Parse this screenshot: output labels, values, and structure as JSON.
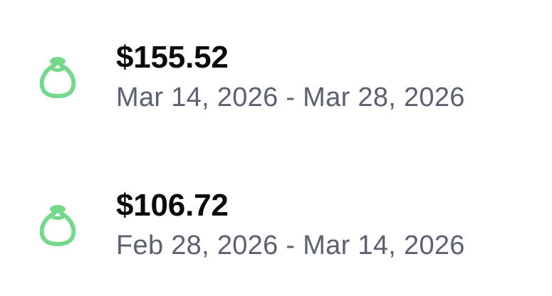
{
  "payments": [
    {
      "icon": "money-bag-icon",
      "amount": "$155.52",
      "date_range": "Mar 14, 2026 - Mar 28, 2026"
    },
    {
      "icon": "money-bag-icon",
      "amount": "$106.72",
      "date_range": "Feb 28, 2026 - Mar 14, 2026"
    }
  ],
  "colors": {
    "icon_accent": "#74d98a",
    "amount_text": "#0b0b0d",
    "secondary_text": "#5b6170",
    "background": "#ffffff"
  }
}
